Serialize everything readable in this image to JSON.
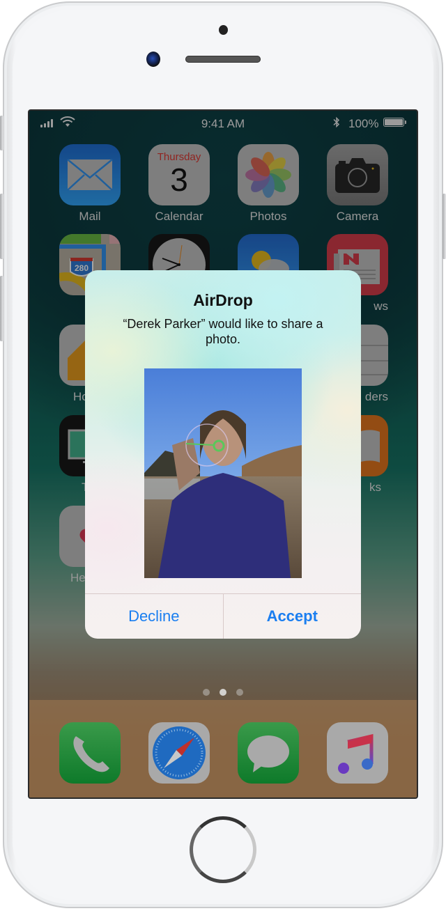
{
  "status_bar": {
    "time": "9:41 AM",
    "battery_percent": "100%",
    "battery_level": 1.0,
    "bluetooth_glyph": "✱",
    "signal_bars": 4
  },
  "home_screen": {
    "apps": [
      {
        "label": "Mail",
        "icon": "mail-icon"
      },
      {
        "label": "Calendar",
        "icon": "calendar-icon",
        "day_name": "Thursday",
        "day_number": "3"
      },
      {
        "label": "Photos",
        "icon": "photos-icon"
      },
      {
        "label": "Camera",
        "icon": "camera-icon"
      },
      {
        "label": "Maps",
        "icon": "maps-icon",
        "visible_label": "M",
        "badge": "280"
      },
      {
        "label": "Clock",
        "icon": "clock-icon"
      },
      {
        "label": "Weather",
        "icon": "weather-icon"
      },
      {
        "label": "News",
        "icon": "news-icon",
        "visible_label": "ws"
      },
      {
        "label": "Home",
        "icon": "home-app-icon",
        "visible_label": "Ho"
      },
      {
        "label": "Reminders",
        "icon": "reminders-icon",
        "visible_label": "ders"
      },
      {
        "label": "TV",
        "icon": "tv-icon",
        "visible_label": "T"
      },
      {
        "label": "Books",
        "icon": "books-icon",
        "visible_label": "ks"
      },
      {
        "label": "Health",
        "icon": "health-icon",
        "visible_label": "He"
      }
    ],
    "page_count": 3,
    "active_page": 2,
    "dock": [
      {
        "label": "Phone",
        "icon": "phone-icon"
      },
      {
        "label": "Safari",
        "icon": "safari-icon"
      },
      {
        "label": "Messages",
        "icon": "messages-icon"
      },
      {
        "label": "Music",
        "icon": "music-icon"
      }
    ]
  },
  "dialog": {
    "title": "AirDrop",
    "message": "“Derek Parker” would like to share a photo.",
    "photo_description": "Girl blowing a bubble on a beach",
    "decline_label": "Decline",
    "accept_label": "Accept"
  },
  "colors": {
    "accent": "#1a7ef0",
    "calendar_red": "#d0312d"
  }
}
